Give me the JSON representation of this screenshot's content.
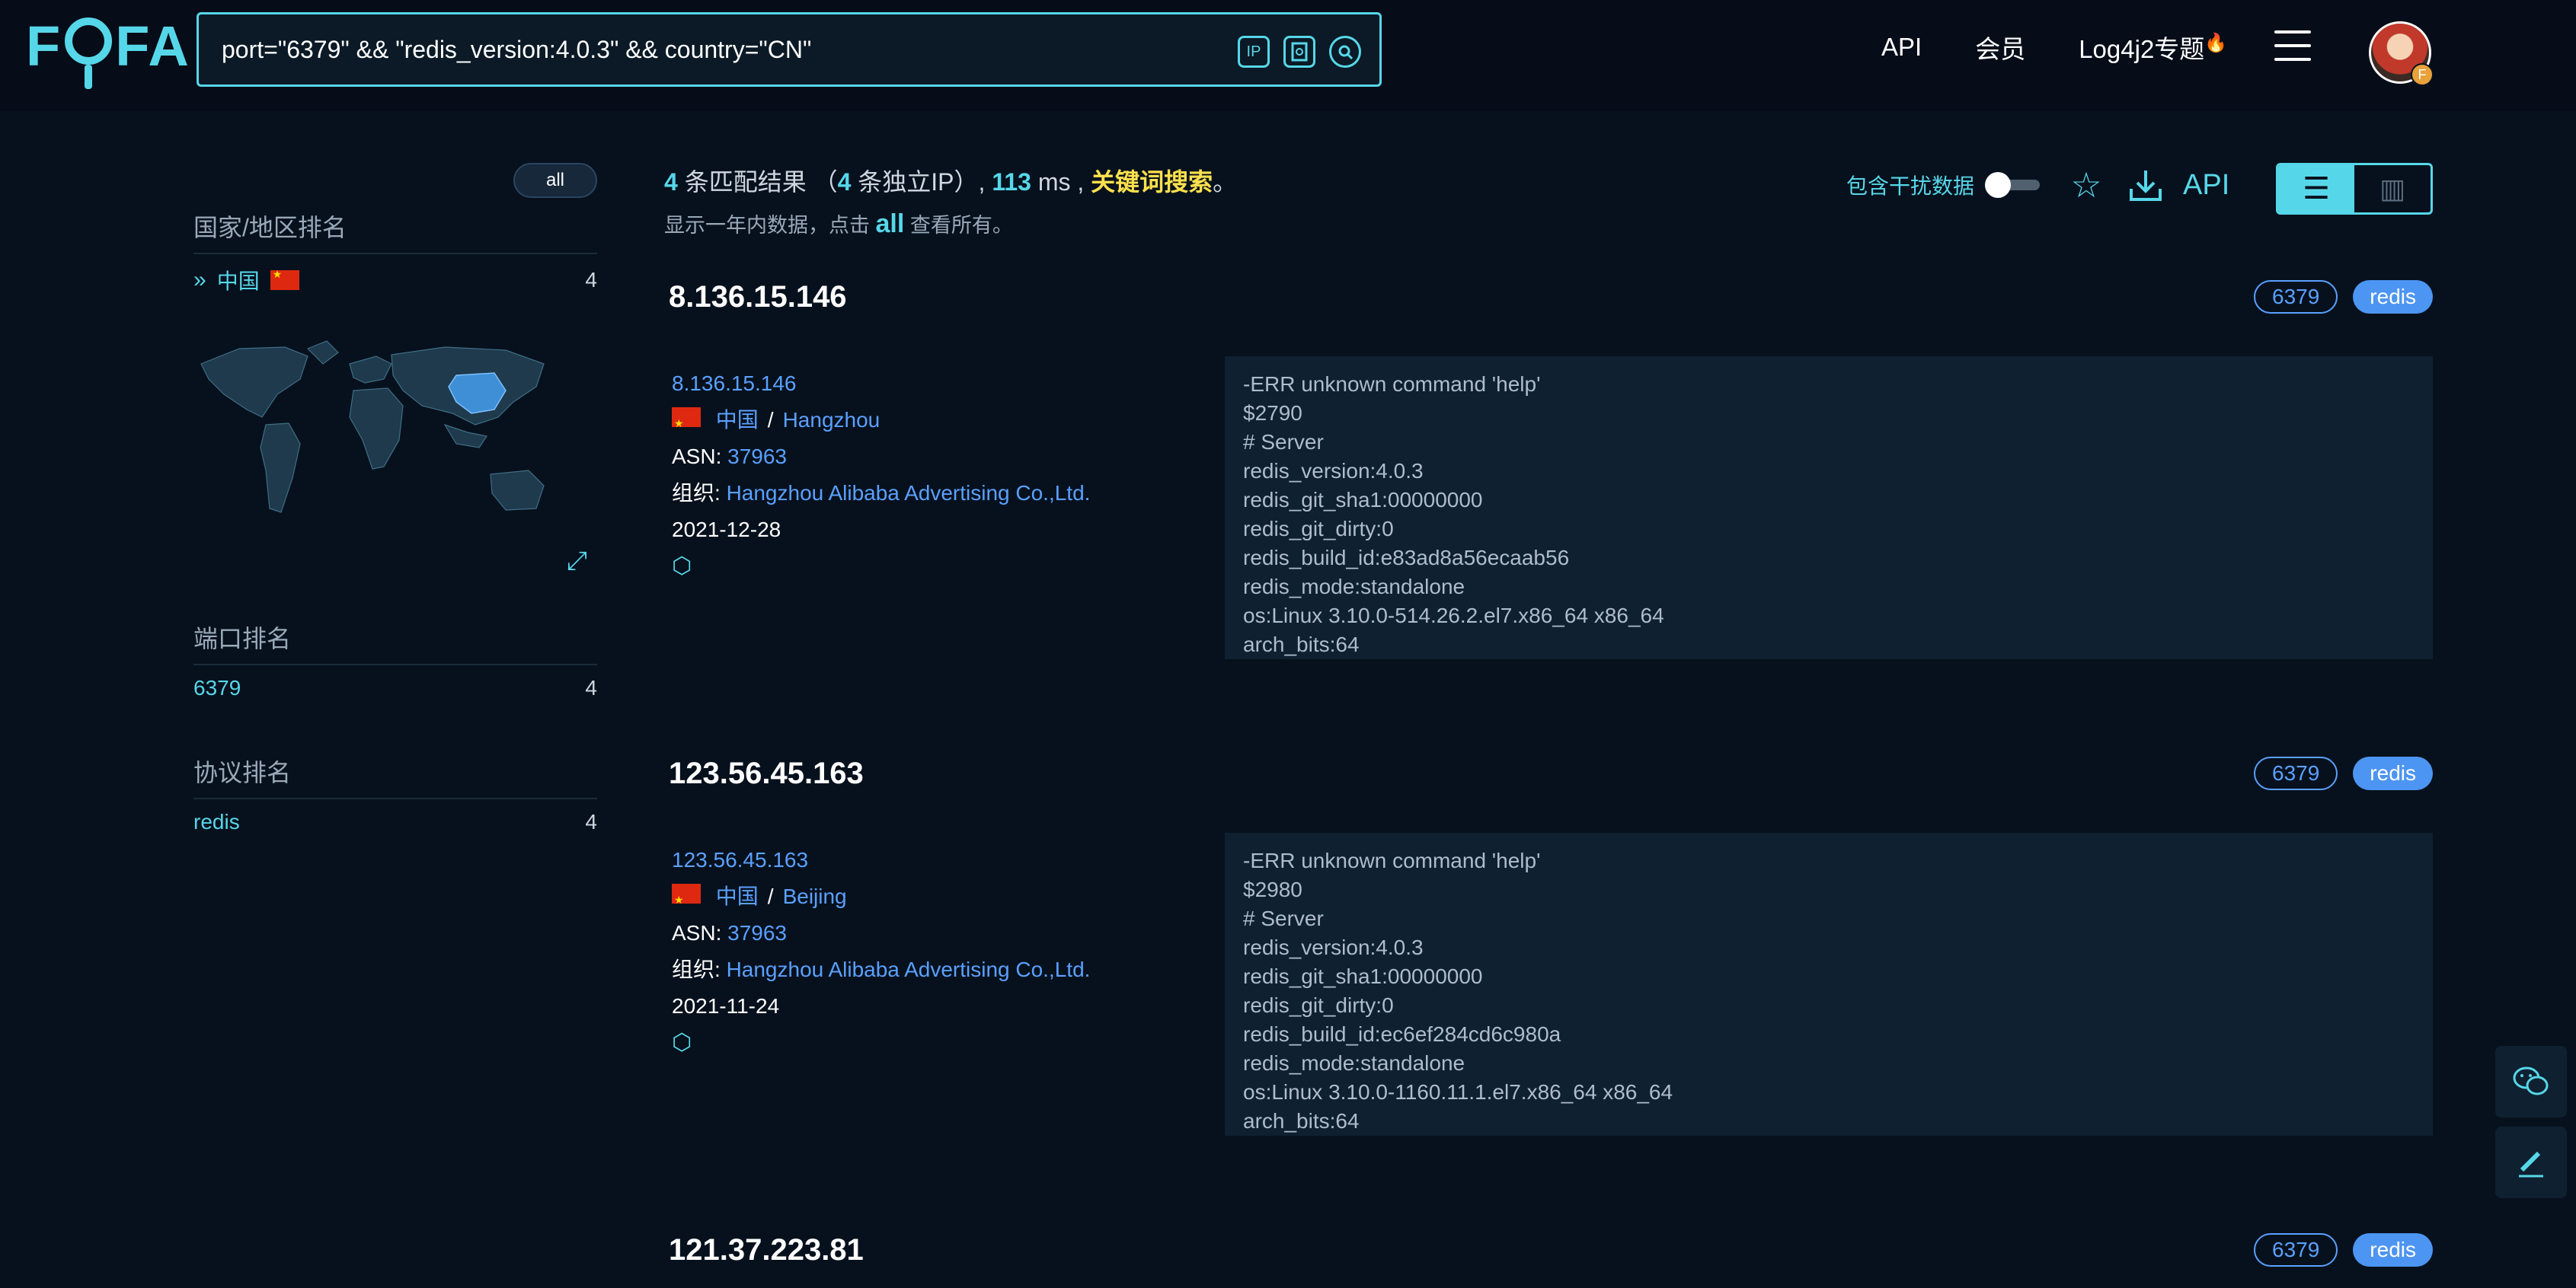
{
  "brand": "FOFA",
  "search": {
    "query": "port=\"6379\" && \"redis_version:4.0.3\" && country=\"CN\"",
    "ip_icon": "IP"
  },
  "nav": {
    "api": "API",
    "member": "会员",
    "log4j": "Log4j2专题"
  },
  "avatar_badge": "F",
  "sidebar": {
    "all_label": "all",
    "country": {
      "title": "国家/地区排名",
      "items": [
        {
          "label": "中国",
          "count": "4"
        }
      ]
    },
    "port": {
      "title": "端口排名",
      "items": [
        {
          "label": "6379",
          "count": "4"
        }
      ]
    },
    "protocol": {
      "title": "协议排名",
      "items": [
        {
          "label": "redis",
          "count": "4"
        }
      ]
    }
  },
  "summary": {
    "count": "4",
    "t1": " 条匹配结果 （",
    "ipcount": "4",
    "t2": " 条独立IP）, ",
    "ms": "113",
    "t3": " ms , ",
    "kw": "关键词搜索",
    "t4": "。",
    "line2a": "显示一年内数据，点击 ",
    "line2all": "all",
    "line2b": " 查看所有。"
  },
  "tools": {
    "interference": "包含干扰数据",
    "api": "API"
  },
  "results": [
    {
      "ip": "8.136.15.146",
      "port_tag": "6379",
      "proto_tag": "redis",
      "country": "中国",
      "city": "Hangzhou",
      "asn_label": "ASN: ",
      "asn": "37963",
      "org_label": "组织: ",
      "org": "Hangzhou Alibaba Advertising Co.,Ltd.",
      "date": "2021-12-28",
      "banner": [
        "-ERR unknown command 'help'",
        "$2790",
        "# Server",
        "redis_version:4.0.3",
        "redis_git_sha1:00000000",
        "redis_git_dirty:0",
        "redis_build_id:e83ad8a56ecaab56",
        "redis_mode:standalone",
        "os:Linux 3.10.0-514.26.2.el7.x86_64 x86_64",
        "arch_bits:64"
      ]
    },
    {
      "ip": "123.56.45.163",
      "port_tag": "6379",
      "proto_tag": "redis",
      "country": "中国",
      "city": "Beijing",
      "asn_label": "ASN: ",
      "asn": "37963",
      "org_label": "组织: ",
      "org": "Hangzhou Alibaba Advertising Co.,Ltd.",
      "date": "2021-11-24",
      "banner": [
        "-ERR unknown command 'help'",
        "$2980",
        "# Server",
        "redis_version:4.0.3",
        "redis_git_sha1:00000000",
        "redis_git_dirty:0",
        "redis_build_id:ec6ef284cd6c980a",
        "redis_mode:standalone",
        "os:Linux 3.10.0-1160.11.1.el7.x86_64 x86_64",
        "arch_bits:64"
      ]
    },
    {
      "ip": "121.37.223.81",
      "port_tag": "6379",
      "proto_tag": "redis"
    }
  ],
  "colors": {
    "accent": "#56d7e9",
    "link": "#5aa0ff",
    "highlight": "#ffe14d",
    "background": "#07111d"
  }
}
